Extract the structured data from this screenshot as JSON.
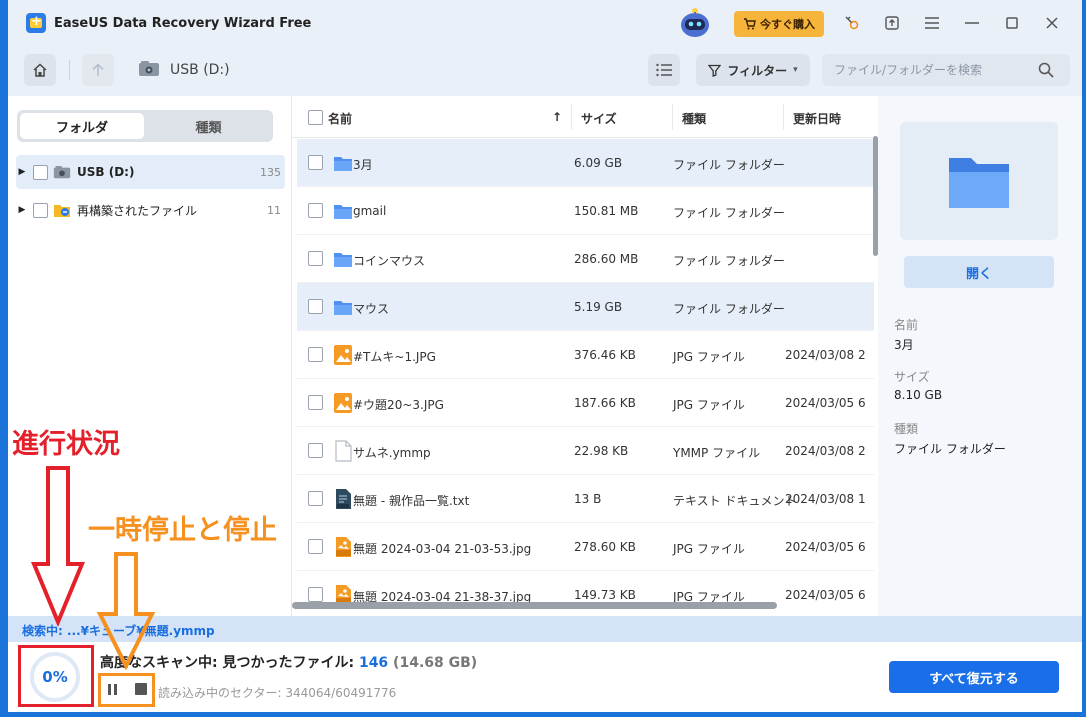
{
  "titlebar": {
    "app_title": "EaseUS Data Recovery Wizard Free",
    "buy_label": "今すぐ購入"
  },
  "toolbar": {
    "path": "USB (D:)",
    "filter_label": "フィルター",
    "search_placeholder": "ファイル/フォルダーを検索"
  },
  "left_panel": {
    "tabs": [
      {
        "label": "フォルダ",
        "active": true
      },
      {
        "label": "種類",
        "active": false
      }
    ],
    "tree": [
      {
        "label": "USB (D:)",
        "count": "135",
        "selected": true
      },
      {
        "label": "再構築されたファイル",
        "count": "11",
        "selected": false
      }
    ]
  },
  "file_list": {
    "columns": [
      "名前",
      "サイズ",
      "種類",
      "更新日時"
    ],
    "rows": [
      {
        "name": "3月",
        "size": "6.09 GB",
        "type": "ファイル フォルダー",
        "date": "",
        "icon": "folder-icon",
        "highlight": true
      },
      {
        "name": "gmail",
        "size": "150.81 MB",
        "type": "ファイル フォルダー",
        "date": "",
        "icon": "folder-icon",
        "highlight": false
      },
      {
        "name": "コインマウス",
        "size": "286.60 MB",
        "type": "ファイル フォルダー",
        "date": "",
        "icon": "folder-icon",
        "highlight": false
      },
      {
        "name": "マウス",
        "size": "5.19 GB",
        "type": "ファイル フォルダー",
        "date": "",
        "icon": "folder-icon",
        "highlight": true
      },
      {
        "name": "#Tムキ~1.JPG",
        "size": "376.46 KB",
        "type": "JPG ファイル",
        "date": "2024/03/08 2",
        "icon": "image-icon",
        "highlight": false
      },
      {
        "name": "#ウ題20~3.JPG",
        "size": "187.66 KB",
        "type": "JPG ファイル",
        "date": "2024/03/05 6",
        "icon": "image-icon",
        "highlight": false
      },
      {
        "name": "サムネ.ymmp",
        "size": "22.98 KB",
        "type": "YMMP ファイル",
        "date": "2024/03/08 2",
        "icon": "document-icon",
        "highlight": false
      },
      {
        "name": "無題 - 親作品一覧.txt",
        "size": "13 B",
        "type": "テキスト ドキュメント",
        "date": "2024/03/08 1",
        "icon": "text-file-icon",
        "highlight": false
      },
      {
        "name": "無題 2024-03-04 21-03-53.jpg",
        "size": "278.60 KB",
        "type": "JPG ファイル",
        "date": "2024/03/05 6",
        "icon": "jpg-icon",
        "highlight": false
      },
      {
        "name": "無題 2024-03-04 21-38-37.jpg",
        "size": "149.73 KB",
        "type": "JPG ファイル",
        "date": "2024/03/05 6",
        "icon": "jpg-icon",
        "highlight": false
      }
    ]
  },
  "details": {
    "open_label": "開く",
    "name_key": "名前",
    "name_value": "3月",
    "size_key": "サイズ",
    "size_value": "8.10 GB",
    "type_key": "種類",
    "type_value": "ファイル フォルダー"
  },
  "status": {
    "searching": "検索中: ...¥キューブ¥無題.ymmp",
    "progress": "0%",
    "progress_value": 0,
    "scan_prefix": "高度なスキャン中: 見つかったファイル: ",
    "found_count": "146",
    "found_size": " (14.68 GB)",
    "sector_text": "読み込み中のセクター: 344064/60491776",
    "recover_all_label": "すべて復元する"
  },
  "annotations": {
    "progress_label": "進行状況",
    "pause_stop_label": "一時停止と停止"
  },
  "colors": {
    "accent": "#1a6fe0",
    "buy": "#f7b43a",
    "annotation_red": "#e4202a",
    "annotation_orange": "#f6901e",
    "folder": "#4f8ff0"
  }
}
